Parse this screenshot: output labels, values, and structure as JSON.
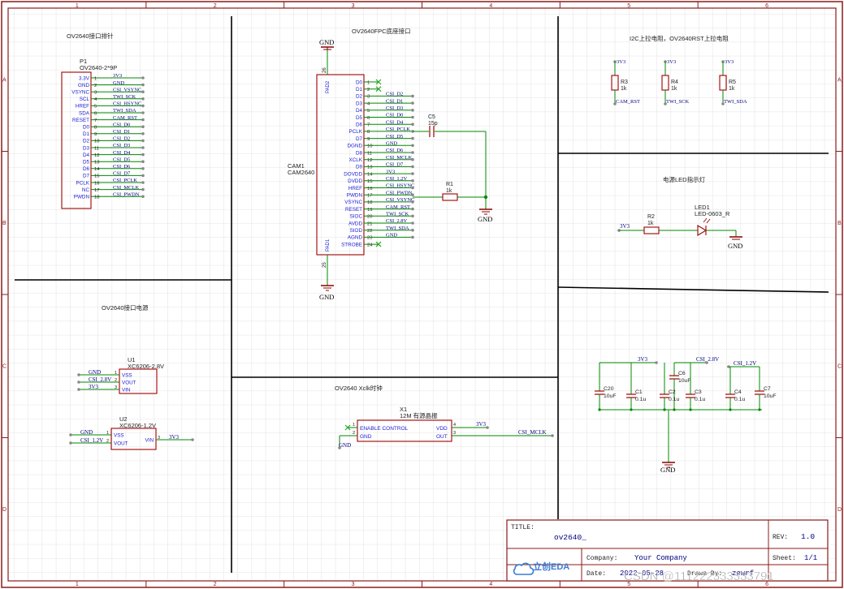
{
  "border": {
    "columns": [
      "1",
      "2",
      "3",
      "4",
      "5",
      "6"
    ],
    "rows": [
      "A",
      "B",
      "C",
      "D"
    ]
  },
  "sections": {
    "ov_header": "OV2640接口排针",
    "fpc": "OV2640FPC底座接口",
    "i2c": "I2C上拉电阻，OV2640RST上拉电阻",
    "led": "电源LED指示灯",
    "power": "OV2640接口电源",
    "xclk": "OV2640 Xclk时钟"
  },
  "p1": {
    "ref": "P1",
    "value": "OV2640-2*9P",
    "pin_names": [
      "3.3V",
      "GND",
      "VSYNC",
      "SCL",
      "HREF",
      "SDA",
      "RESET",
      "D0",
      "D1",
      "D2",
      "D3",
      "D4",
      "D5",
      "D6",
      "D7",
      "PCLK",
      "NC",
      "PWDN"
    ],
    "pin_numbers": [
      "1",
      "2",
      "3",
      "4",
      "5",
      "6",
      "7",
      "8",
      "9",
      "10",
      "11",
      "12",
      "13",
      "14",
      "15",
      "16",
      "17",
      "18"
    ],
    "nets": [
      "3V3",
      "GND",
      "CSI_VSYNC",
      "TWI_SCK",
      "CSI_HSYNC",
      "TWI_SDA",
      "CAM_RST",
      "CSI_D0",
      "CSI_D1",
      "CSI_D2",
      "CSI_D3",
      "CSI_D4",
      "CSI_D5",
      "CSI_D6",
      "CSI_D7",
      "CSI_PCLK",
      "CSI_MCLK",
      "CSI_PWDN"
    ]
  },
  "cam1": {
    "ref": "CAM1",
    "value": "CAM2640",
    "pad2": "PAD2",
    "pad1": "PAD1",
    "pad2_num": "26",
    "pad1_num": "25",
    "pin_names": [
      "D0",
      "D1",
      "D2",
      "D3",
      "D4",
      "D5",
      "D6",
      "PCLK",
      "D7",
      "DGND",
      "D8",
      "XCLK",
      "D9",
      "DOVDD",
      "DVDD",
      "HREF",
      "PWDN",
      "VSYNC",
      "RESET",
      "SIOC",
      "AVDD",
      "SIOD",
      "AGND",
      "STROBE"
    ],
    "pin_numbers": [
      "1",
      "2",
      "3",
      "4",
      "5",
      "6",
      "7",
      "8",
      "9",
      "10",
      "11",
      "12",
      "13",
      "14",
      "15",
      "16",
      "17",
      "18",
      "19",
      "20",
      "21",
      "22",
      "23",
      "24"
    ],
    "nets": [
      "",
      "",
      "CSI_D2",
      "CSI_D1",
      "CSI_D3",
      "CSI_D0",
      "CSI_D4",
      "CSI_PCLK",
      "CSI_D5",
      "GND",
      "CSI_D6",
      "CSI_MCLK",
      "CSI_D7",
      "3V3",
      "CSI_1.2V",
      "CSI_HSYNC",
      "CSI_PWDN",
      "CSI_VSYNC",
      "CAM_RST",
      "TWI_SCK",
      "CSI_2.8V",
      "TWI_SDA",
      "GND",
      ""
    ]
  },
  "c5": {
    "ref": "C5",
    "value": "15p"
  },
  "r1": {
    "ref": "R1",
    "value": "1k"
  },
  "gnd_label": "GND",
  "pullups": [
    {
      "ref": "R3",
      "value": "1k",
      "rail": "3V3",
      "net": "CAM_RST"
    },
    {
      "ref": "R4",
      "value": "1k",
      "rail": "3V3",
      "net": "TWI_SCK"
    },
    {
      "ref": "R5",
      "value": "1k",
      "rail": "3V3",
      "net": "TWI_SDA"
    }
  ],
  "led": {
    "rail": "3V3",
    "r_ref": "R2",
    "r_value": "1k",
    "led_ref": "LED1",
    "led_value": "LED-0603_R"
  },
  "u1": {
    "ref": "U1",
    "value": "XC6206-2.8V",
    "pins": [
      "VSS",
      "VOUT",
      "VIN"
    ],
    "pin_numbers": [
      "1",
      "2",
      "3"
    ],
    "nets": [
      "GND",
      "CSI_2.8V",
      "3V3"
    ]
  },
  "u2": {
    "ref": "U2",
    "value": "XC6206-1.2V",
    "pins": [
      "VSS",
      "VOUT",
      "VIN"
    ],
    "pin_numbers": [
      "1",
      "2",
      "3"
    ],
    "nets": [
      "GND",
      "CSI_1.2V",
      "3V3"
    ]
  },
  "x1": {
    "ref": "X1",
    "value": "12M 有源晶振",
    "pins": [
      "ENABLE CONTROL",
      "GND",
      "VDD",
      "OUT"
    ],
    "pin_numbers": [
      "1",
      "2",
      "4",
      "3"
    ],
    "nets": [
      "GND",
      "3V3",
      "CSI_MCLK"
    ]
  },
  "decoupling": {
    "rails": [
      "3V3",
      "CSI_2.8V",
      "CSI_1.2V"
    ],
    "caps": [
      {
        "ref": "C20",
        "value": "10uF"
      },
      {
        "ref": "C1",
        "value": "0.1u"
      },
      {
        "ref": "C6",
        "value": "10uF"
      },
      {
        "ref": "C2",
        "value": "0.1u"
      },
      {
        "ref": "C3",
        "value": "0.1u"
      },
      {
        "ref": "C4",
        "value": "0.1u"
      },
      {
        "ref": "C7",
        "value": "10uF"
      }
    ]
  },
  "title_block": {
    "title_label": "TITLE:",
    "title": "ov2640_",
    "rev_label": "REV:",
    "rev": "1.0",
    "logo": "立创EDA",
    "company_label": "Company:",
    "company": "Your Company",
    "sheet_label": "Sheet:",
    "sheet": "1/1",
    "date_label": "Date:",
    "date": "2022-05-28",
    "drawn_label": "Drawn By:",
    "drawn": "zewrf"
  },
  "watermark": "CSDN @111222333333791",
  "colors": {
    "border": "#8b1a1a",
    "wire": "#008800",
    "net_label": "#000080",
    "pin_name": "#1b1bd3",
    "part_outline": "#a00000",
    "grid": "#d8d8d8",
    "gnd": "#8b0000",
    "nc": "#22aa22"
  }
}
